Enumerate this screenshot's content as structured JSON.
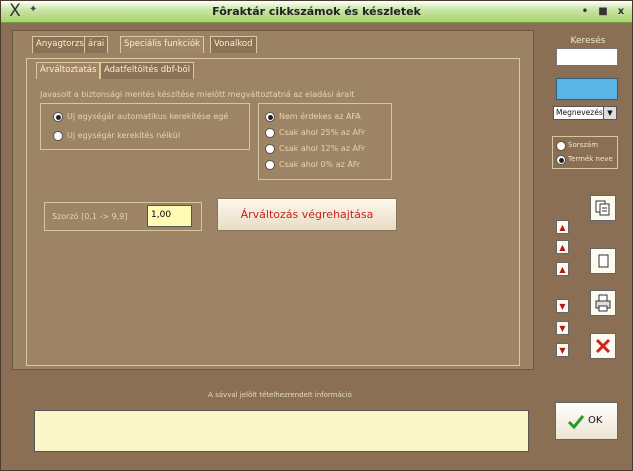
{
  "window": {
    "title": "Fôraktár cikkszámok és készletek",
    "controls": [
      "•",
      "■",
      "x"
    ]
  },
  "tabs": [
    "Anyagtorzs",
    "árai",
    "Speciális funkciók",
    "Vonalkod"
  ],
  "subtabs": [
    "Árváltoztatás",
    "Adatfeltöltés dbf-böl"
  ],
  "hint": "Javasolt  a biztonsági mentés készítése mielôtt megváltoztatná az eladási árait",
  "rounding_options": [
    {
      "label": "Uj egységár automatikus kerekítése egé",
      "selected": true
    },
    {
      "label": "Uj egységár kerekítés nélkül",
      "selected": false
    }
  ],
  "vat_options": [
    {
      "label": "Nem érdekes az ÁFA",
      "selected": true
    },
    {
      "label": "Csak ahol 25% az ÁFr",
      "selected": false
    },
    {
      "label": "Csak ahol 12% az ÁFr",
      "selected": false
    },
    {
      "label": "Csak ahol  0% az ÁFr",
      "selected": false
    }
  ],
  "multiplier": {
    "label": "Szorzó [0,1 -> 9,9]",
    "value": "1,00"
  },
  "execute_button": "Árváltozás végrehajtása",
  "info_label": "A sávval jelölt tételhezrendelt információ",
  "search": {
    "title": "Keresés",
    "value": "",
    "select_value": "Megnevezés"
  },
  "sort_options": [
    {
      "label": "Sorszám",
      "selected": false
    },
    {
      "label": "Termék neve",
      "selected": true
    }
  ],
  "nav_buttons": [
    "▲",
    "▲",
    "▲",
    "▼",
    "▼",
    "▼"
  ],
  "ok_label": "OK",
  "colors": {
    "panel": "#9c8264",
    "accent_blue": "#5ab4e6",
    "title_green": "#a8d46c",
    "exec_text": "#c8231f"
  }
}
